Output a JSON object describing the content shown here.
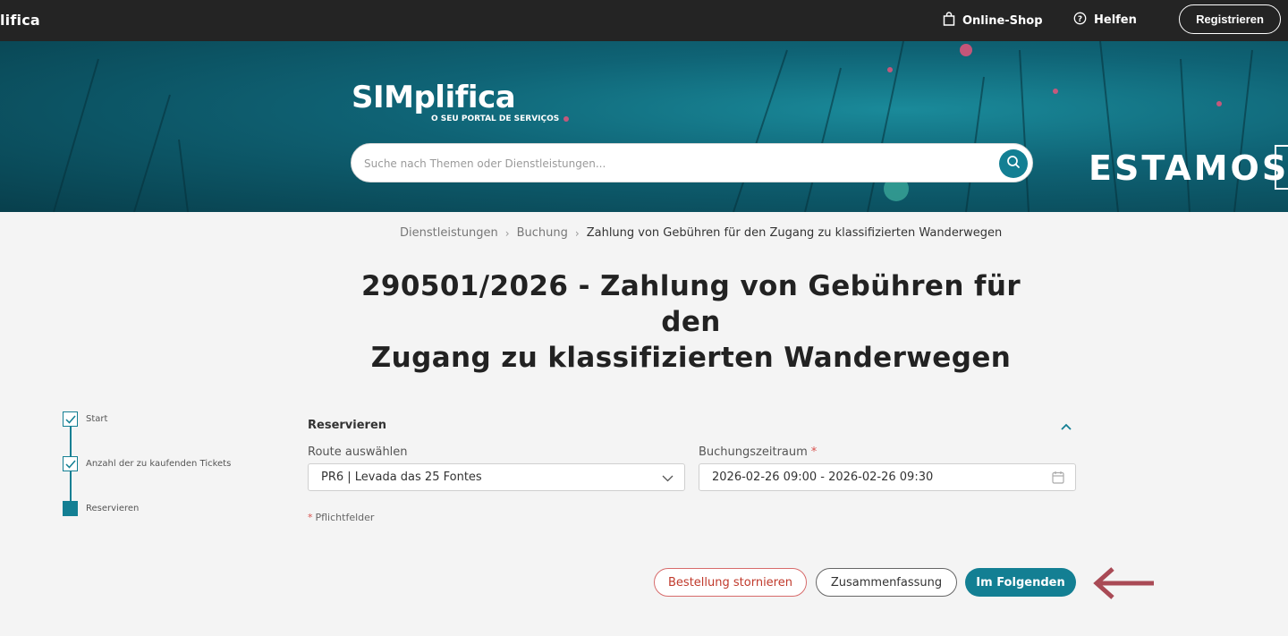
{
  "topbar": {
    "brand": "lifica",
    "shop_label": "Online-Shop",
    "help_label": "Helfen",
    "register_label": "Registrieren"
  },
  "hero": {
    "logo_text": "SIMplifica",
    "logo_tagline": "O SEU PORTAL DE SERVIÇOS",
    "search_placeholder": "Suche nach Themen oder Dienstleistungen...",
    "promo_text": "ESTAMOS"
  },
  "breadcrumb": {
    "items": [
      "Dienstleistungen",
      "Buchung"
    ],
    "current": "Zahlung von Gebühren für den Zugang zu klassifizierten Wanderwegen"
  },
  "page": {
    "title_line1": "290501/2026 - Zahlung von Gebühren für den",
    "title_line2": "Zugang zu klassifizierten Wanderwegen"
  },
  "stepper": {
    "steps": [
      {
        "label": "Start",
        "state": "done"
      },
      {
        "label": "Anzahl der zu kaufenden Tickets",
        "state": "done"
      },
      {
        "label": "Reservieren",
        "state": "current"
      }
    ]
  },
  "form": {
    "section_title": "Reservieren",
    "route_label": "Route auswählen",
    "route_value": "PR6 | Levada das 25 Fontes",
    "period_label": "Buchungszeitraum",
    "period_required_mark": "*",
    "period_value": "2026-02-26 09:00 - 2026-02-26 09:30",
    "required_mark": "*",
    "required_note": "Pflichtfelder"
  },
  "actions": {
    "cancel_label": "Bestellung stornieren",
    "summary_label": "Zusammenfassung",
    "next_label": "Im Folgenden"
  },
  "colors": {
    "accent": "#137f93",
    "topbar": "#242424",
    "danger": "#c0392b",
    "arrow": "#a94a55"
  }
}
